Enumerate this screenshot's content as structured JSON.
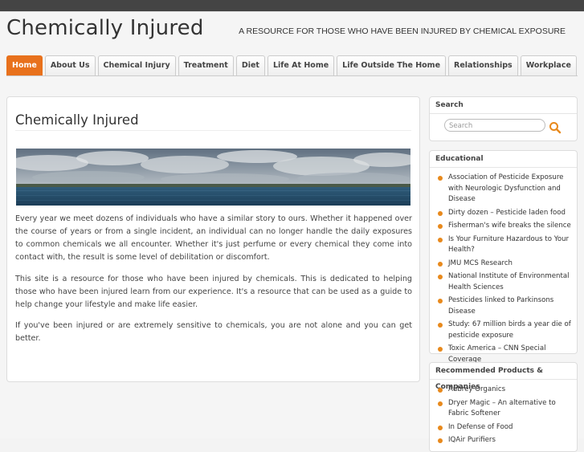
{
  "site": {
    "title": "Chemically Injured",
    "description": "A RESOURCE FOR THOSE WHO HAVE BEEN INJURED BY CHEMICAL EXPOSURE"
  },
  "nav": {
    "items": [
      {
        "label": "Home"
      },
      {
        "label": "About Us"
      },
      {
        "label": "Chemical Injury"
      },
      {
        "label": "Treatment"
      },
      {
        "label": "Diet"
      },
      {
        "label": "Life At Home"
      },
      {
        "label": "Life Outside The Home"
      },
      {
        "label": "Relationships"
      },
      {
        "label": "Workplace"
      }
    ],
    "active_index": 0
  },
  "main": {
    "title": "Chemically Injured",
    "paragraphs": [
      "Every year we meet dozens of individuals who have a similar story to ours. Whether it happened over the course of years or from a single incident, an individual can no longer handle the daily exposures to common chemicals we all encounter. Whether it's just perfume or every chemical they come into contact with, the result is some level of debilitation or discomfort.",
      "This site is a resource for those who have been injured by chemicals. This is dedicated to helping those who have been injured learn from our experience. It's a resource that can be used as a guide to help change your lifestyle and make life easier.",
      "If you've been injured or are extremely sensitive to chemicals, you are not alone and you can get better."
    ]
  },
  "sidebar": {
    "search": {
      "title": "Search",
      "placeholder": "Search"
    },
    "educational": {
      "title": "Educational",
      "links": [
        "Association of Pesticide Exposure with Neurologic Dysfunction and Disease",
        "Dirty dozen – Pesticide laden food",
        "Fisherman's wife breaks the silence",
        "Is Your Furniture Hazardous to Your Health?",
        "JMU MCS Research",
        "National Institute of Environmental Health Sciences",
        "Pesticides linked to Parkinsons Disease",
        "Study: 67 million birds a year die of pesticide exposure",
        "Toxic America – CNN Special Coverage"
      ]
    },
    "products": {
      "title": "Recommended Products & Companies",
      "links": [
        "Aubrey Organics",
        "Dryer Magic – An alternative to Fabric Softener",
        "In Defense of Food",
        "IQAir Purifiers"
      ]
    }
  },
  "colors": {
    "accent": "#e8711c",
    "bullet": "#e8891c"
  }
}
